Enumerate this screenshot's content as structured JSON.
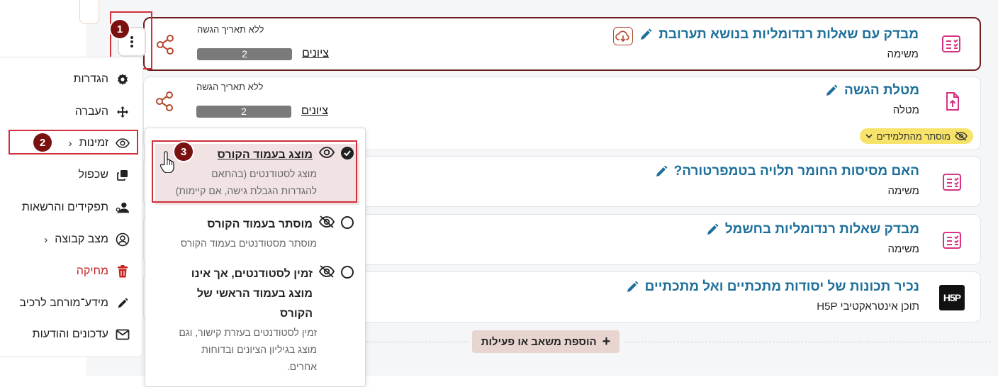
{
  "activities": [
    {
      "title": "מבדק עם שאלות רנדומליות בנושא תערובת",
      "type": "משימה",
      "due": "ללא תאריך הגשה",
      "grades_link": "ציונים",
      "count": "2",
      "icon": "quiz-icon"
    },
    {
      "title": "מטלת הגשה",
      "type": "מטלה",
      "due": "ללא תאריך הגשה",
      "grades_link": "ציונים",
      "count": "2",
      "badge": "מוסתר מהתלמידים",
      "icon": "upload-file-icon"
    },
    {
      "title": "האם מסיסות החומר תלויה בטמפרטורה?",
      "type": "משימה",
      "icon": "quiz-icon"
    },
    {
      "title": "מבדק שאלות רנדומליות בחשמל",
      "type": "משימה",
      "icon": "quiz-icon"
    },
    {
      "title": "נכיר תכונות של יסודות מתכתיים ואל מתכתיים",
      "type": "תוכן אינטראקטיבי H5P",
      "icon": "h5p-icon",
      "icon_text": "H5P"
    }
  ],
  "action_menu": {
    "items": [
      {
        "label": "הגדרות",
        "icon": "gear-icon"
      },
      {
        "label": "העברה",
        "icon": "move-icon"
      },
      {
        "label": "זמינות",
        "icon": "eye-icon",
        "has_submenu": true
      },
      {
        "label": "שכפול",
        "icon": "duplicate-icon"
      },
      {
        "label": "תפקידים והרשאות",
        "icon": "user-key-icon"
      },
      {
        "label": "מצב קבוצה",
        "icon": "group-icon",
        "has_submenu": true
      },
      {
        "label": "מחיקה",
        "icon": "trash-icon",
        "danger": true
      },
      {
        "label": "מידע־מורחב לרכיב",
        "icon": "pencil-icon"
      },
      {
        "label": "עדכונים והודעות",
        "icon": "envelope-icon"
      }
    ]
  },
  "availability_submenu": {
    "options": [
      {
        "title": "מוצג בעמוד הקורס",
        "desc_lines": [
          "מוצג לסטודנטים (בהתאם",
          "להגדרות הגבלת גישה, אם קיימות)"
        ],
        "selected": true
      },
      {
        "title": "מוסתר בעמוד הקורס",
        "desc_lines": [
          "מוסתר מסטודנטים בעמוד הקורס"
        ],
        "selected": false
      },
      {
        "title_lines": [
          "זמין לסטודנטים, אך אינו",
          "מוצג בעמוד הראשי של",
          "הקורס"
        ],
        "desc_lines": [
          "זמין לסטודנטים בעזרת קישור, וגם",
          "מוצג בגיליון הציונים ובדוחות",
          "אחרים."
        ],
        "selected": false
      }
    ]
  },
  "step_markers": [
    "1",
    "2",
    "3"
  ],
  "add_activity_button": "הוספת משאב או פעילות",
  "colors": {
    "accent": "#6b1d1d",
    "title_link": "#1d6f9a",
    "quiz_icon": "#d63384",
    "highlight": "#d0303a",
    "step_badge": "#7a1111"
  }
}
